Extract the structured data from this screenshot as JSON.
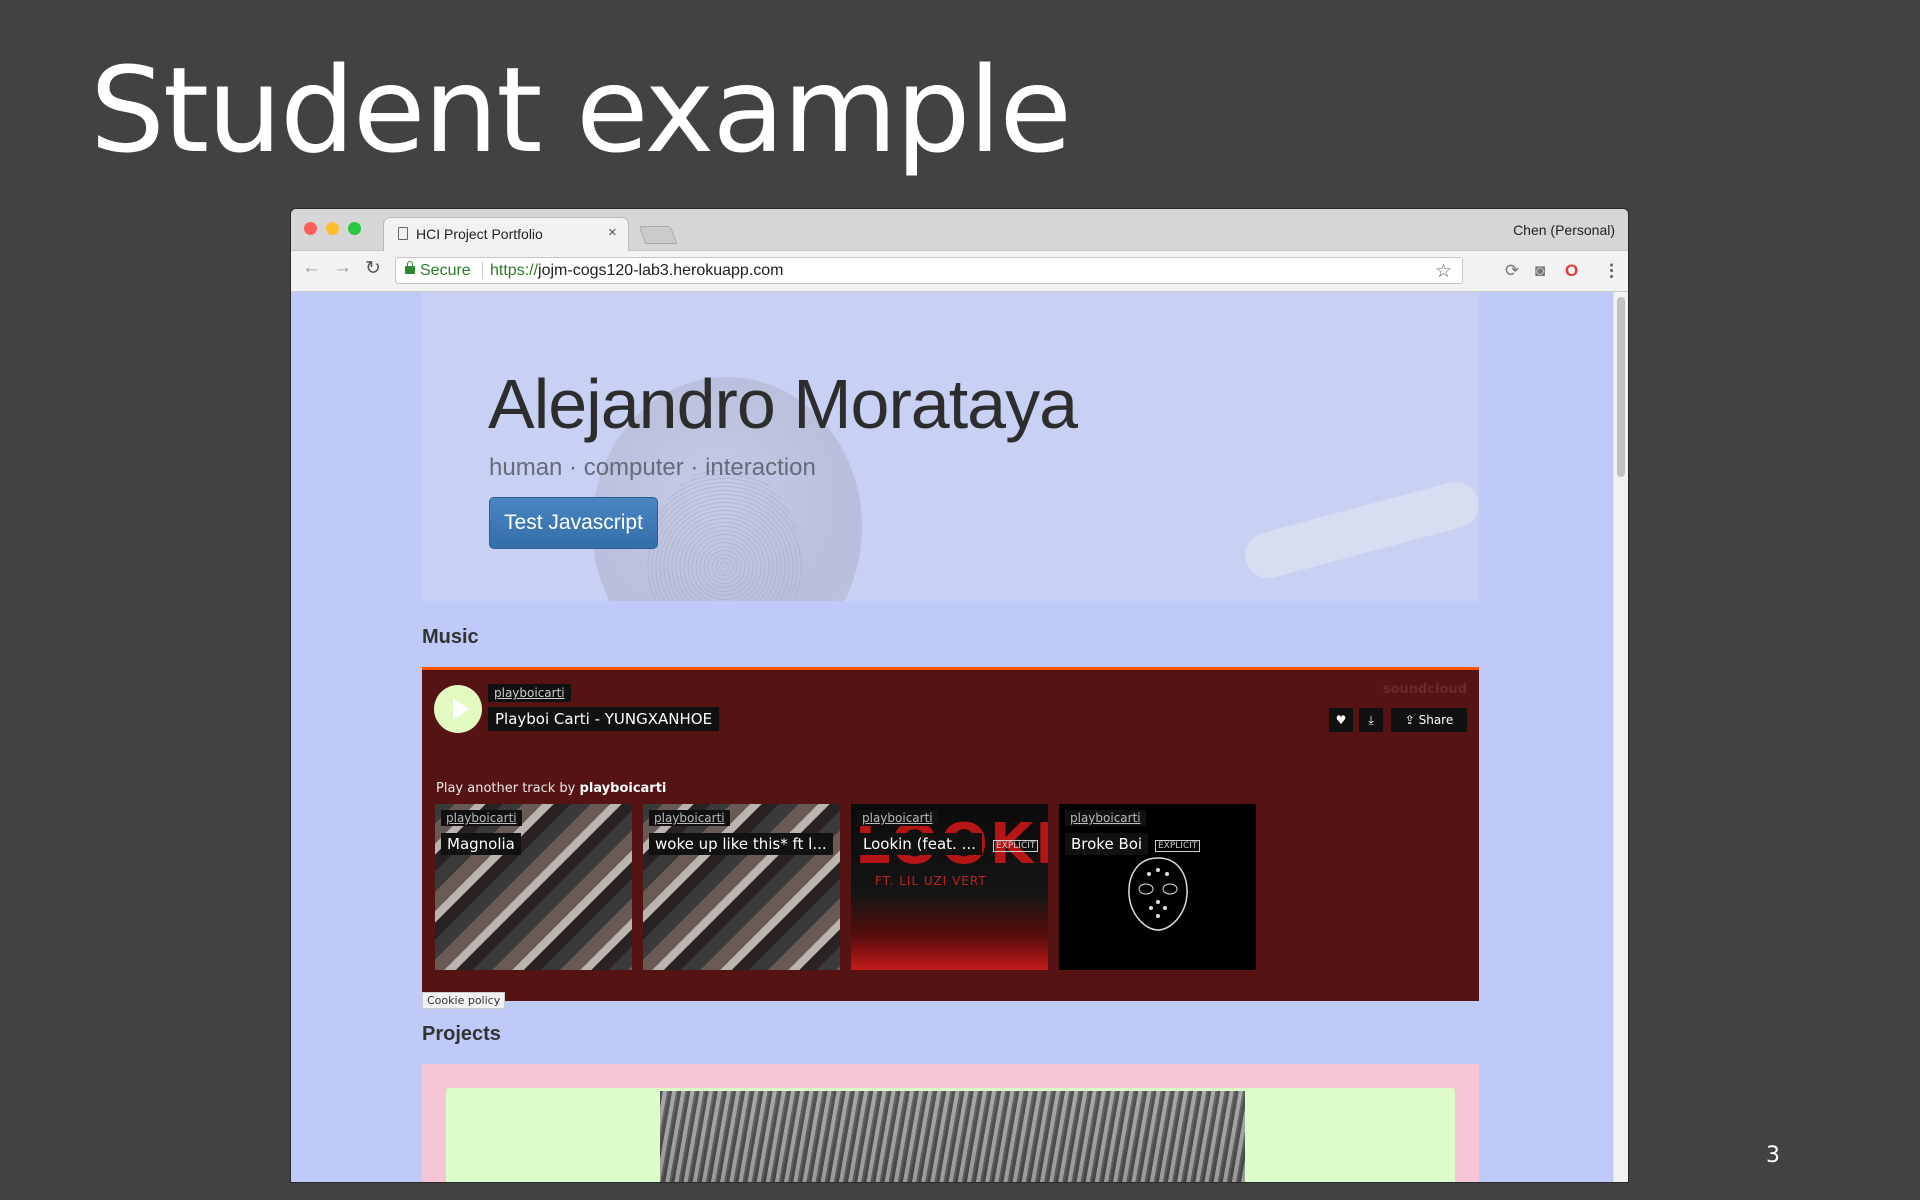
{
  "slide": {
    "title": "Student example",
    "page_number": "3"
  },
  "browser": {
    "tab_title": "HCI Project Portfolio",
    "tab_close": "×",
    "profile": "Chen (Personal)",
    "secure_label": "Secure",
    "url_scheme": "https://",
    "url_host": "jojm-cogs120-lab3.herokuapp.com",
    "back": "←",
    "forward": "→",
    "reload": "↻",
    "star": "☆",
    "menu": "⋮"
  },
  "hero": {
    "name": "Alejandro Morataya",
    "subtitle": "human · computer · interaction",
    "button_label": "Test Javascript"
  },
  "music": {
    "heading": "Music",
    "player": {
      "user": "playboicarti",
      "track": "Playboi Carti - YUNGXANHOE",
      "logo_text": "soundcloud",
      "like_icon": "♥",
      "download_icon": "⤓",
      "share_label": "Share",
      "another_prefix": "Play another track by",
      "another_user": "playboicarti",
      "cookie": "Cookie policy"
    },
    "tracks": [
      {
        "user": "playboicarti",
        "title": "Magnolia",
        "explicit": ""
      },
      {
        "user": "playboicarti",
        "title": "woke up like this* ft l...",
        "explicit": ""
      },
      {
        "user": "playboicarti",
        "title": "Lookin (feat. ...",
        "explicit": "EXPLICIT"
      },
      {
        "user": "playboicarti",
        "title": "Broke Boi",
        "explicit": "EXPLICIT"
      }
    ],
    "lookin_art": {
      "big": "LOOKIN",
      "sub": "FT. LIL UZI VERT"
    }
  },
  "projects": {
    "heading": "Projects"
  },
  "colors": {
    "page_bg": "#bfcaf8",
    "player_bg": "#561313",
    "soundcloud_orange": "#ff5500",
    "projects_bg": "#f7c6d4",
    "project_card": "#dcfcc8",
    "button_blue": "#3d78b5"
  }
}
